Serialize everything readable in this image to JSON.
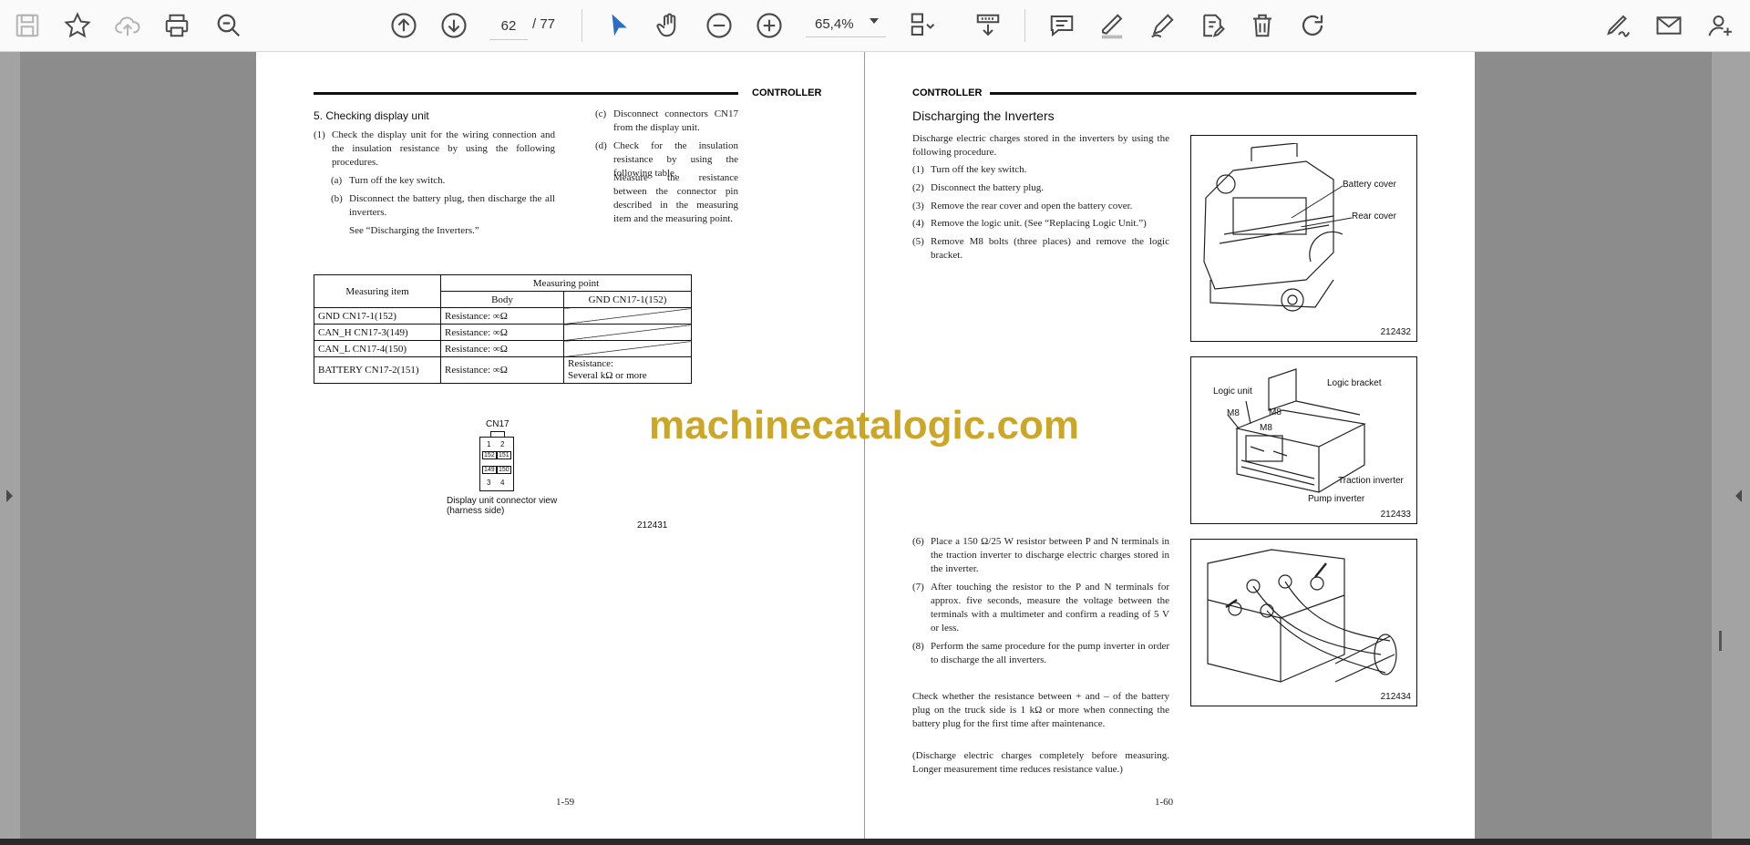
{
  "toolbar": {
    "page_current": "62",
    "page_total": "/ 77",
    "zoom": "65,4%",
    "icons": [
      "save-icon",
      "bookmark-star-icon",
      "upload-cloud-icon",
      "print-icon",
      "zoom-search-icon",
      "page-up-icon",
      "page-down-icon",
      "select-cursor-icon",
      "hand-tool-icon",
      "zoom-out-icon",
      "zoom-in-icon",
      "page-layout-icon",
      "scroll-mode-icon",
      "comment-icon",
      "highlight-pen-icon",
      "draw-icon",
      "edit-text-icon",
      "delete-icon",
      "rotate-icon",
      "sign-icon",
      "email-icon",
      "add-user-icon"
    ]
  },
  "watermark": "machinecatalogic.com",
  "left_page": {
    "header": "CONTROLLER",
    "section_title": "5. Checking display unit",
    "col1": [
      {
        "n": "(1)",
        "t": "Check the display unit for the wiring connection and the insulation resistance by using the following procedures."
      },
      {
        "n": "(a)",
        "t": "Turn off the key switch."
      },
      {
        "n": "(b)",
        "t": "Disconnect the battery plug, then discharge the all inverters."
      },
      {
        "n": "",
        "t": "See “Discharging the Inverters.”"
      }
    ],
    "col2": [
      {
        "n": "(c)",
        "t": "Disconnect connectors CN17 from the display unit."
      },
      {
        "n": "(d)",
        "t": "Check for the insulation resistance by using the following table."
      },
      {
        "n": "",
        "t": "Measure the resistance between the connector pin described in the measuring item and the measuring point."
      }
    ],
    "table": {
      "h_item": "Measuring item",
      "h_point": "Measuring point",
      "h_body": "Body",
      "h_gnd": "GND CN17-1(152)",
      "rows": [
        {
          "item": "GND CN17-1(152)",
          "body": "Resistance: ∞Ω",
          "gnd": ""
        },
        {
          "item": "CAN_H CN17-3(149)",
          "body": "Resistance: ∞Ω",
          "gnd": ""
        },
        {
          "item": "CAN_L CN17-4(150)",
          "body": "Resistance: ∞Ω",
          "gnd": ""
        },
        {
          "item": "BATTERY CN17-2(151)",
          "body": "Resistance: ∞Ω",
          "gnd": "Resistance:\nSeveral kΩ or more"
        }
      ]
    },
    "connector": {
      "title": "CN17",
      "pins": [
        "1",
        "2",
        "152",
        "151",
        "149",
        "150",
        "3",
        "4"
      ],
      "caption1": "Display unit connector view",
      "caption2": "(harness side)",
      "fig_id": "212431"
    },
    "page_number": "1-59"
  },
  "right_page": {
    "header": "CONTROLLER",
    "section_title": "Discharging the Inverters",
    "intro": "Discharge electric charges stored in the inverters by using the following procedure.",
    "steps_a": [
      {
        "n": "(1)",
        "t": "Turn off the key switch."
      },
      {
        "n": "(2)",
        "t": "Disconnect the battery plug."
      },
      {
        "n": "(3)",
        "t": "Remove the rear cover and open the battery cover."
      },
      {
        "n": "(4)",
        "t": "Remove the logic unit. (See “Replacing Logic Unit.”)"
      },
      {
        "n": "(5)",
        "t": "Remove M8 bolts (three places) and remove the logic bracket."
      }
    ],
    "steps_b": [
      {
        "n": "(6)",
        "t": "Place a 150 Ω/25 W resistor between P and N terminals in the traction inverter to discharge electric charges stored in the inverter."
      },
      {
        "n": "(7)",
        "t": "After touching the resistor to the P and N terminals for approx. five seconds, measure the voltage between the terminals with a multimeter and confirm a reading of 5 V or less."
      },
      {
        "n": "(8)",
        "t": "Perform the same procedure for the pump inverter in order to discharge the all inverters."
      }
    ],
    "note1": "Check whether the resistance between + and – of the battery plug on the truck side is 1 kΩ or more when connecting the battery plug for the first time after maintenance.",
    "note2": "(Discharge electric charges completely before measuring. Longer measurement time reduces resistance value.)",
    "fig1": {
      "label1": "Battery cover",
      "label2": "Rear cover",
      "id": "212432"
    },
    "fig2": {
      "label1": "Logic unit",
      "label2": "Logic bracket",
      "label3": "M8",
      "label4": "M8",
      "label5": "M8",
      "label6": "Traction inverter",
      "label7": "Pump inverter",
      "id": "212433"
    },
    "fig3": {
      "id": "212434"
    },
    "page_number": "1-60"
  }
}
